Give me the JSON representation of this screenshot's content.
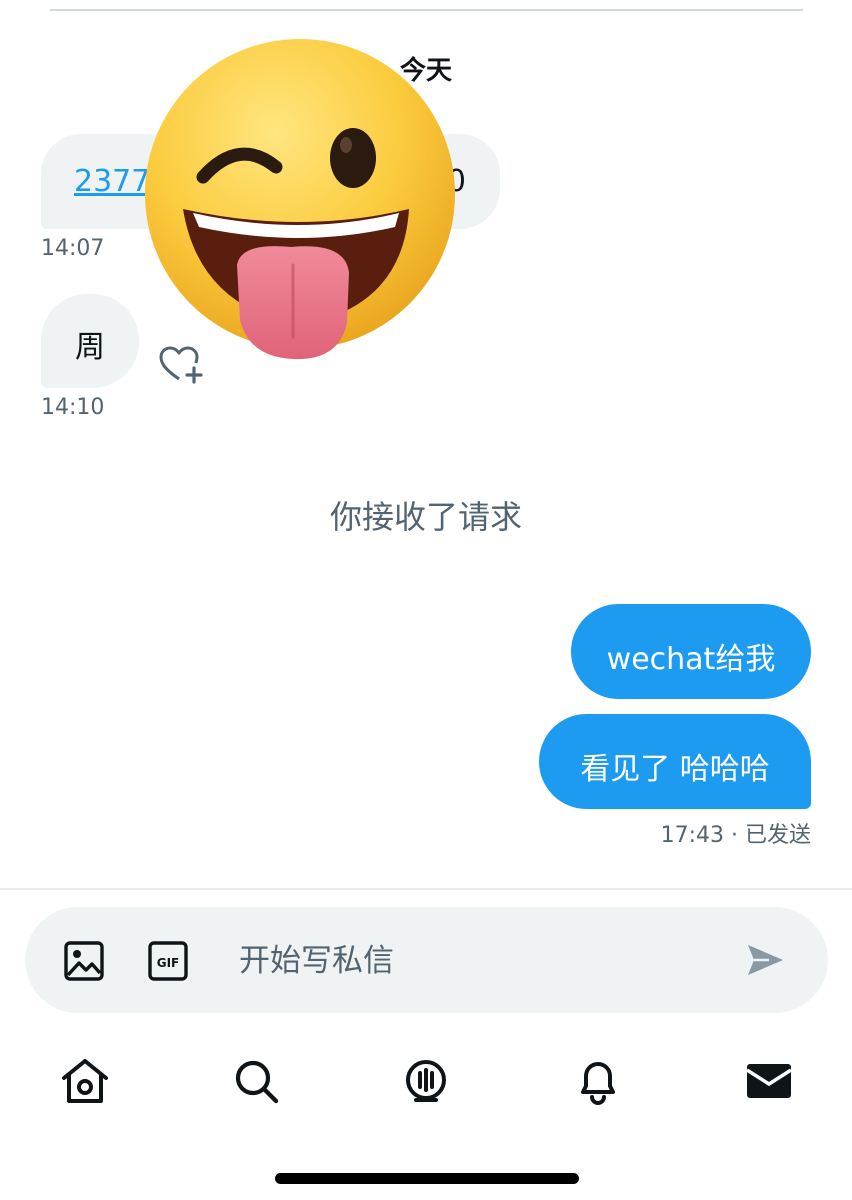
{
  "conversation": {
    "date_label": "今天",
    "incoming": [
      {
        "link_text": "2377",
        "trail_text": "0",
        "time": "14:07"
      },
      {
        "text": "周",
        "time": "14:10"
      }
    ],
    "system_message": "你接收了请求",
    "outgoing": [
      {
        "text": "wechat给我"
      },
      {
        "text": "看见了 哈哈哈"
      }
    ],
    "outgoing_meta": "17:43 · 已发送"
  },
  "composer": {
    "placeholder": "开始写私信",
    "gif_label": "GIF"
  },
  "icons": {
    "overlay": "wink-tongue-emoji-icon",
    "reaction": "heart-plus-icon",
    "image": "image-icon",
    "gif": "gif-icon",
    "send": "send-icon",
    "nav": [
      "home-icon",
      "search-icon",
      "spaces-icon",
      "bell-icon",
      "mail-icon"
    ]
  },
  "colors": {
    "accent": "#1d9bf0",
    "incoming_bubble": "#eff3f4",
    "secondary_text": "#536471"
  }
}
